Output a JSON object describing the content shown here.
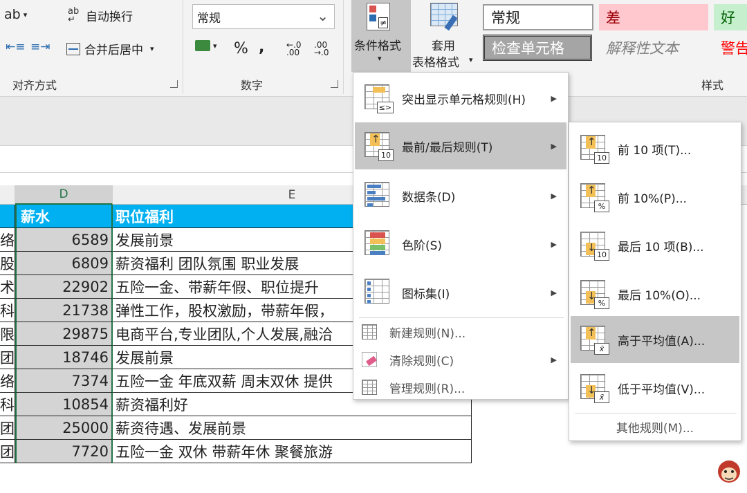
{
  "ribbon": {
    "alignment": {
      "wrap_label": "自动换行",
      "merge_label": "合并后居中",
      "group_label": "对齐方式"
    },
    "number": {
      "format_value": "常规",
      "percent": "%",
      "comma": ",",
      "group_label": "数字"
    },
    "conditional_format_label": "条件格式",
    "table_format_label_1": "套用",
    "table_format_label_2": "表格格式",
    "styles": {
      "normal": "常规",
      "bad": "差",
      "good": "好",
      "check_cell": "检查单元格",
      "explanatory": "解释性文本",
      "warning": "警告",
      "group_label": "样式"
    }
  },
  "sheet": {
    "col_d": "D",
    "col_e": "E",
    "header": {
      "d": "薪水",
      "e": "职位福利"
    },
    "rows": [
      {
        "c": "络",
        "d": "6589",
        "e": "发展前景"
      },
      {
        "c": "股",
        "d": "6809",
        "e": "薪资福利 团队氛围 职业发展"
      },
      {
        "c": "术",
        "d": "22902",
        "e": "五险一金、带薪年假、职位提升"
      },
      {
        "c": "科",
        "d": "21738",
        "e": "弹性工作，股权激励，带薪年假，"
      },
      {
        "c": "限",
        "d": "29875",
        "e": "电商平台,专业团队,个人发展,融洽"
      },
      {
        "c": "团",
        "d": "18746",
        "e": "发展前景"
      },
      {
        "c": "络",
        "d": "7374",
        "e": "五险一金 年底双薪 周末双休 提供"
      },
      {
        "c": "科",
        "d": "10854",
        "e": "薪资福利好"
      },
      {
        "c": "团",
        "d": "25000",
        "e": "薪资待遇、发展前景"
      },
      {
        "c": "团",
        "d": "7720",
        "e": "五险一金 双休 带薪年休 聚餐旅游"
      }
    ]
  },
  "cf_menu": {
    "items": [
      {
        "label": "突出显示单元格规则(H)"
      },
      {
        "label": "最前/最后规则(T)"
      },
      {
        "label": "数据条(D)"
      },
      {
        "label": "色阶(S)"
      },
      {
        "label": "图标集(I)"
      },
      {
        "label": "新建规则(N)..."
      },
      {
        "label": "清除规则(C)"
      },
      {
        "label": "管理规则(R)..."
      }
    ]
  },
  "submenu": {
    "items": [
      {
        "label": "前 10 项(T)...",
        "badge": "10"
      },
      {
        "label": "前 10%(P)...",
        "badge": "%"
      },
      {
        "label": "最后 10 项(B)...",
        "badge": "10"
      },
      {
        "label": "最后 10%(O)...",
        "badge": "%"
      },
      {
        "label": "高于平均值(A)...",
        "badge": "x̄"
      },
      {
        "label": "低于平均值(V)...",
        "badge": "x̄"
      }
    ],
    "more": "其他规则(M)..."
  },
  "colors": {
    "header_blue": "#00b0f0",
    "selected_gray": "#c6c6c6",
    "bad_bg": "#ffc7ce",
    "good_bg": "#c6efce",
    "warning_red": "#ff0000"
  }
}
